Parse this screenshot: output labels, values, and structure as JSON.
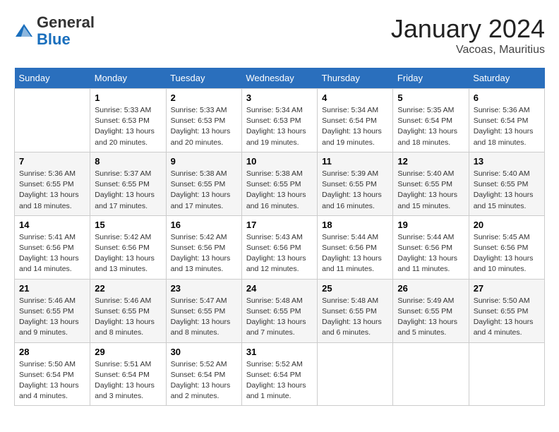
{
  "header": {
    "logo": {
      "general": "General",
      "blue": "Blue"
    },
    "title": "January 2024",
    "location": "Vacoas, Mauritius"
  },
  "calendar": {
    "days_of_week": [
      "Sunday",
      "Monday",
      "Tuesday",
      "Wednesday",
      "Thursday",
      "Friday",
      "Saturday"
    ],
    "weeks": [
      [
        {
          "day": "",
          "info": ""
        },
        {
          "day": "1",
          "info": "Sunrise: 5:33 AM\nSunset: 6:53 PM\nDaylight: 13 hours\nand 20 minutes."
        },
        {
          "day": "2",
          "info": "Sunrise: 5:33 AM\nSunset: 6:53 PM\nDaylight: 13 hours\nand 20 minutes."
        },
        {
          "day": "3",
          "info": "Sunrise: 5:34 AM\nSunset: 6:53 PM\nDaylight: 13 hours\nand 19 minutes."
        },
        {
          "day": "4",
          "info": "Sunrise: 5:34 AM\nSunset: 6:54 PM\nDaylight: 13 hours\nand 19 minutes."
        },
        {
          "day": "5",
          "info": "Sunrise: 5:35 AM\nSunset: 6:54 PM\nDaylight: 13 hours\nand 18 minutes."
        },
        {
          "day": "6",
          "info": "Sunrise: 5:36 AM\nSunset: 6:54 PM\nDaylight: 13 hours\nand 18 minutes."
        }
      ],
      [
        {
          "day": "7",
          "info": "Sunrise: 5:36 AM\nSunset: 6:55 PM\nDaylight: 13 hours\nand 18 minutes."
        },
        {
          "day": "8",
          "info": "Sunrise: 5:37 AM\nSunset: 6:55 PM\nDaylight: 13 hours\nand 17 minutes."
        },
        {
          "day": "9",
          "info": "Sunrise: 5:38 AM\nSunset: 6:55 PM\nDaylight: 13 hours\nand 17 minutes."
        },
        {
          "day": "10",
          "info": "Sunrise: 5:38 AM\nSunset: 6:55 PM\nDaylight: 13 hours\nand 16 minutes."
        },
        {
          "day": "11",
          "info": "Sunrise: 5:39 AM\nSunset: 6:55 PM\nDaylight: 13 hours\nand 16 minutes."
        },
        {
          "day": "12",
          "info": "Sunrise: 5:40 AM\nSunset: 6:55 PM\nDaylight: 13 hours\nand 15 minutes."
        },
        {
          "day": "13",
          "info": "Sunrise: 5:40 AM\nSunset: 6:55 PM\nDaylight: 13 hours\nand 15 minutes."
        }
      ],
      [
        {
          "day": "14",
          "info": "Sunrise: 5:41 AM\nSunset: 6:56 PM\nDaylight: 13 hours\nand 14 minutes."
        },
        {
          "day": "15",
          "info": "Sunrise: 5:42 AM\nSunset: 6:56 PM\nDaylight: 13 hours\nand 13 minutes."
        },
        {
          "day": "16",
          "info": "Sunrise: 5:42 AM\nSunset: 6:56 PM\nDaylight: 13 hours\nand 13 minutes."
        },
        {
          "day": "17",
          "info": "Sunrise: 5:43 AM\nSunset: 6:56 PM\nDaylight: 13 hours\nand 12 minutes."
        },
        {
          "day": "18",
          "info": "Sunrise: 5:44 AM\nSunset: 6:56 PM\nDaylight: 13 hours\nand 11 minutes."
        },
        {
          "day": "19",
          "info": "Sunrise: 5:44 AM\nSunset: 6:56 PM\nDaylight: 13 hours\nand 11 minutes."
        },
        {
          "day": "20",
          "info": "Sunrise: 5:45 AM\nSunset: 6:56 PM\nDaylight: 13 hours\nand 10 minutes."
        }
      ],
      [
        {
          "day": "21",
          "info": "Sunrise: 5:46 AM\nSunset: 6:55 PM\nDaylight: 13 hours\nand 9 minutes."
        },
        {
          "day": "22",
          "info": "Sunrise: 5:46 AM\nSunset: 6:55 PM\nDaylight: 13 hours\nand 8 minutes."
        },
        {
          "day": "23",
          "info": "Sunrise: 5:47 AM\nSunset: 6:55 PM\nDaylight: 13 hours\nand 8 minutes."
        },
        {
          "day": "24",
          "info": "Sunrise: 5:48 AM\nSunset: 6:55 PM\nDaylight: 13 hours\nand 7 minutes."
        },
        {
          "day": "25",
          "info": "Sunrise: 5:48 AM\nSunset: 6:55 PM\nDaylight: 13 hours\nand 6 minutes."
        },
        {
          "day": "26",
          "info": "Sunrise: 5:49 AM\nSunset: 6:55 PM\nDaylight: 13 hours\nand 5 minutes."
        },
        {
          "day": "27",
          "info": "Sunrise: 5:50 AM\nSunset: 6:55 PM\nDaylight: 13 hours\nand 4 minutes."
        }
      ],
      [
        {
          "day": "28",
          "info": "Sunrise: 5:50 AM\nSunset: 6:54 PM\nDaylight: 13 hours\nand 4 minutes."
        },
        {
          "day": "29",
          "info": "Sunrise: 5:51 AM\nSunset: 6:54 PM\nDaylight: 13 hours\nand 3 minutes."
        },
        {
          "day": "30",
          "info": "Sunrise: 5:52 AM\nSunset: 6:54 PM\nDaylight: 13 hours\nand 2 minutes."
        },
        {
          "day": "31",
          "info": "Sunrise: 5:52 AM\nSunset: 6:54 PM\nDaylight: 13 hours\nand 1 minute."
        },
        {
          "day": "",
          "info": ""
        },
        {
          "day": "",
          "info": ""
        },
        {
          "day": "",
          "info": ""
        }
      ]
    ]
  }
}
